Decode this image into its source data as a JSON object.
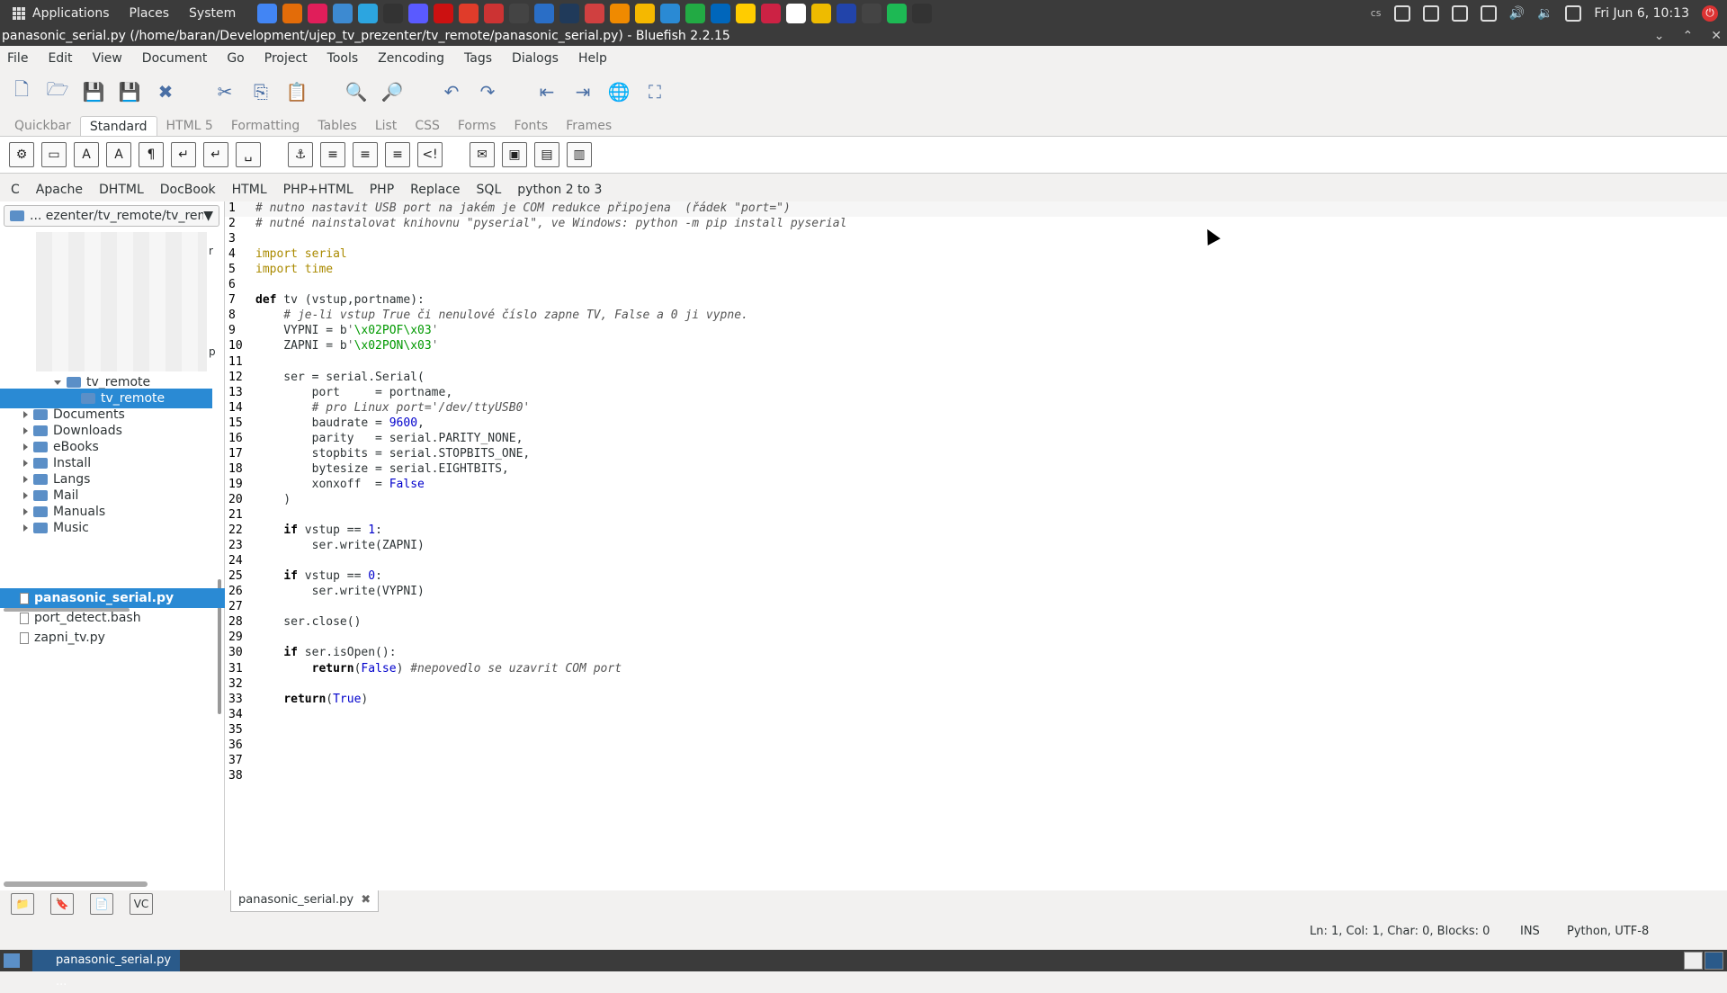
{
  "topbar": {
    "menus": [
      "Applications",
      "Places",
      "System"
    ],
    "clock": "Fri Jun 6, 10:13",
    "keyboard_layout": "cs",
    "launcher_colors": [
      "#4285f4",
      "#e36c09",
      "#e01e5a",
      "#3d8ad1",
      "#2ca5e0",
      "#333333",
      "#5a5aff",
      "#cc1111",
      "#e03c2a",
      "#cc3333",
      "#444444",
      "#2a6ec6",
      "#203a5a",
      "#d04040",
      "#f08a00",
      "#f5b800",
      "#2a8ad4",
      "#22aa44",
      "#0066bb",
      "#ffcc00",
      "#cc2244",
      "#ffffff",
      "#eebb00",
      "#2244aa",
      "#444444",
      "#1db954",
      "#333333"
    ]
  },
  "window": {
    "title": "panasonic_serial.py (/home/baran/Development/ujep_tv_prezenter/tv_remote/panasonic_serial.py) - Bluefish 2.2.15"
  },
  "menubar": [
    "File",
    "Edit",
    "View",
    "Document",
    "Go",
    "Project",
    "Tools",
    "Zencoding",
    "Tags",
    "Dialogs",
    "Help"
  ],
  "toolbar_icons": [
    "new-file-icon",
    "open-icon",
    "save-icon",
    "save-as-icon",
    "close-icon",
    "cut-icon",
    "copy-icon",
    "paste-icon",
    "find-icon",
    "replace-icon",
    "undo-icon",
    "redo-icon",
    "indent-icon",
    "unindent-icon",
    "preview-icon",
    "fullscreen-icon"
  ],
  "tabs": [
    "Quickbar",
    "Standard",
    "HTML 5",
    "Formatting",
    "Tables",
    "List",
    "CSS",
    "Forms",
    "Fonts",
    "Frames"
  ],
  "active_tab": "Standard",
  "html_tools": [
    "quickstart-icon",
    "body-icon",
    "bold-icon",
    "italic-icon",
    "paragraph-icon",
    "break-icon",
    "break-clear-icon",
    "nbsp-icon",
    "anchor-icon",
    "hr-icon",
    "center-icon",
    "right-align-icon",
    "comment-icon",
    "email-icon",
    "image-icon",
    "thumbnail-icon",
    "multi-thumbnail-icon"
  ],
  "html_tool_glyphs": [
    "⚙",
    "▭",
    "A",
    "A",
    "¶",
    "↵",
    "↵",
    "␣",
    "⚓",
    "≡",
    "≡",
    "≡",
    "<!",
    "✉",
    "▣",
    "▤",
    "▥"
  ],
  "custom_menu": [
    "C",
    "Apache",
    "DHTML",
    "DocBook",
    "HTML",
    "PHP+HTML",
    "PHP",
    "Replace",
    "SQL",
    "python 2 to 3"
  ],
  "sidebar": {
    "path": "... ezenter/tv_remote/tv_remote",
    "tree": [
      {
        "label": "tv_remote",
        "level": 2,
        "expanded": true
      },
      {
        "label": "tv_remote",
        "level": 3,
        "selected": true
      },
      {
        "label": "Documents",
        "level": 1
      },
      {
        "label": "Downloads",
        "level": 1
      },
      {
        "label": "eBooks",
        "level": 1
      },
      {
        "label": "Install",
        "level": 1
      },
      {
        "label": "Langs",
        "level": 1
      },
      {
        "label": "Mail",
        "level": 1
      },
      {
        "label": "Manuals",
        "level": 1
      },
      {
        "label": "Music",
        "level": 1
      }
    ],
    "tree_edge_letters": [
      "r",
      "p"
    ],
    "files": [
      "panasonic_serial.py",
      "port_detect.bash",
      "zapni_tv.py"
    ],
    "selected_file": "panasonic_serial.py"
  },
  "editor": {
    "lines": [
      "# nutno nastavit USB port na jakém je COM redukce připojena  (řádek \"port=\")",
      "# nutné nainstalovat knihovnu \"pyserial\", ve Windows: python -m pip install pyserial",
      "",
      "import serial",
      "import time",
      "",
      "def tv (vstup,portname):",
      "    # je-li vstup True či nenulové číslo zapne TV, False a 0 ji vypne.",
      "    VYPNI = b'\\x02POF\\x03'",
      "    ZAPNI = b'\\x02PON\\x03'",
      "",
      "    ser = serial.Serial(",
      "        port     = portname,",
      "        # pro Linux port='/dev/ttyUSB0'",
      "        baudrate = 9600,",
      "        parity   = serial.PARITY_NONE,",
      "        stopbits = serial.STOPBITS_ONE,",
      "        bytesize = serial.EIGHTBITS,",
      "        xonxoff  = False",
      "    )",
      "",
      "    if vstup == 1:",
      "        ser.write(ZAPNI)",
      "",
      "    if vstup == 0:",
      "        ser.write(VYPNI)",
      "",
      "    ser.close()",
      "",
      "    if ser.isOpen():",
      "        return(False) #nepovedlo se uzavrit COM port",
      "",
      "    return(True)",
      "",
      "",
      "",
      "",
      ""
    ],
    "current_line": 1
  },
  "document_tab": {
    "label": "panasonic_serial.py",
    "close": "✖"
  },
  "statusbar": {
    "position": "Ln: 1, Col: 1, Char: 0, Blocks: 0",
    "mode": "INS",
    "language": "Python, UTF-8"
  },
  "taskbar": {
    "task_label": "panasonic_serial.py ..."
  }
}
